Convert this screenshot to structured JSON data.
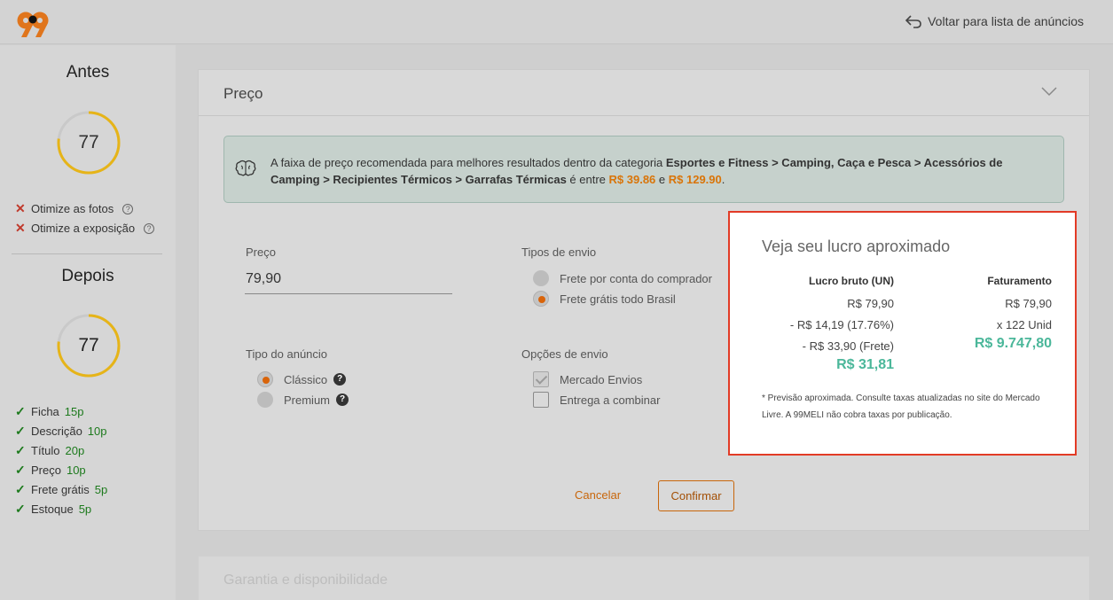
{
  "header": {
    "back_label": "Voltar para lista de anúncios"
  },
  "sidebar": {
    "before_title": "Antes",
    "before_score": "77",
    "issues": [
      {
        "label": "Otimize as fotos"
      },
      {
        "label": "Otimize a exposição"
      }
    ],
    "after_title": "Depois",
    "after_score": "77",
    "achievements": [
      {
        "label": "Ficha",
        "points": "15p"
      },
      {
        "label": "Descrição",
        "points": "10p"
      },
      {
        "label": "Título",
        "points": "20p"
      },
      {
        "label": "Preço",
        "points": "10p"
      },
      {
        "label": "Frete grátis",
        "points": "5p"
      },
      {
        "label": "Estoque",
        "points": "5p"
      }
    ]
  },
  "card": {
    "title": "Preço",
    "info": {
      "prefix": "A faixa de preço recomendada para melhores resultados dentro da categoria ",
      "category": "Esportes e Fitness > Camping, Caça e Pesca > Acessórios de Camping > Recipientes Térmicos > Garrafas Térmicas",
      "middle": " é entre ",
      "min": "R$ 39.86",
      "and": " e ",
      "max": "R$ 129.90",
      "end": "."
    },
    "price_label": "Preço",
    "price_value": "79,90",
    "shipping_type_label": "Tipos de envio",
    "shipping_types": [
      "Frete por conta do comprador",
      "Frete grátis todo Brasil"
    ],
    "listing_type_label": "Tipo do anúncio",
    "listing_types": [
      "Clássico",
      "Premium"
    ],
    "shipping_options_label": "Opções de envio",
    "shipping_options": [
      "Mercado Envios",
      "Entrega a combinar"
    ],
    "cancel_label": "Cancelar",
    "confirm_label": "Confirmar"
  },
  "profit": {
    "title": "Veja seu lucro aproximado",
    "gross_header": "Lucro bruto (UN)",
    "gross_lines": [
      "R$ 79,90",
      "- R$ 14,19 (17.76%)",
      "- R$ 33,90 (Frete)"
    ],
    "gross_total": "R$ 31,81",
    "revenue_header": "Faturamento",
    "revenue_lines": [
      "R$ 79,90",
      "x 122 Unid"
    ],
    "revenue_total": "R$ 9.747,80",
    "note": "* Previsão aproximada. Consulte taxas atualizadas no site do Mercado Livre. A 99MELI não cobra taxas por publicação."
  },
  "next_section": {
    "title": "Garantia e disponibilidade"
  },
  "colors": {
    "accent": "#d97408",
    "profit_green": "#4bb79a",
    "highlight_border": "#e23b26"
  }
}
